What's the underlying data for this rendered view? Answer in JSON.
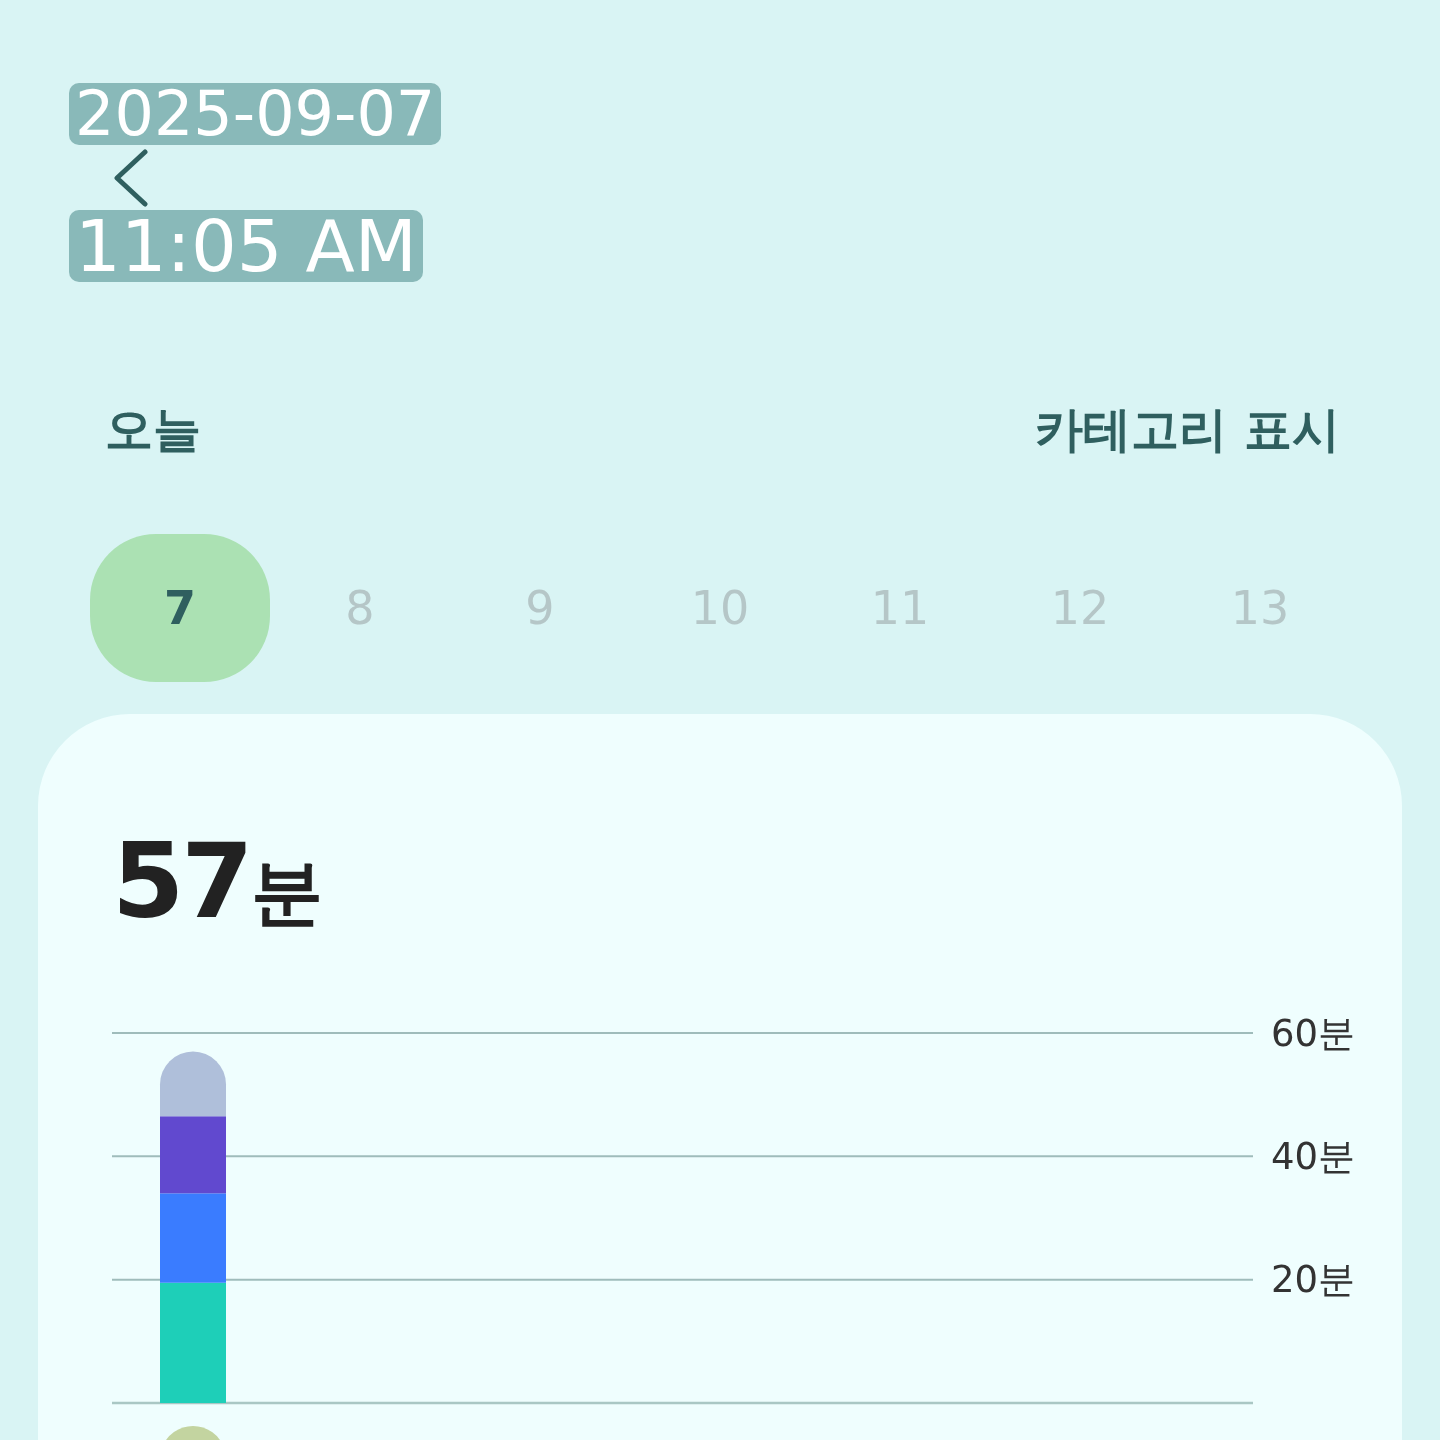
{
  "status": {
    "date": "2025-09-07",
    "time": "11:05 AM"
  },
  "header": {
    "title": "오늘",
    "action": "카테고리 표시"
  },
  "days": [
    {
      "label": "7",
      "selected": true
    },
    {
      "label": "8",
      "selected": false
    },
    {
      "label": "9",
      "selected": false
    },
    {
      "label": "10",
      "selected": false
    },
    {
      "label": "11",
      "selected": false
    },
    {
      "label": "12",
      "selected": false
    },
    {
      "label": "13",
      "selected": false
    }
  ],
  "summary": {
    "total_value": "57",
    "total_unit": "분",
    "chart_data": {
      "type": "bar",
      "stacked": true,
      "ylim": [
        0,
        60
      ],
      "yticks": [
        {
          "value": 20,
          "label": "20분"
        },
        {
          "value": 40,
          "label": "40분"
        },
        {
          "value": 60,
          "label": "60분"
        }
      ],
      "series": [
        {
          "color": "#1ecfb8",
          "values": [
            19.5
          ]
        },
        {
          "color": "#3a7cff",
          "values": [
            14.5
          ]
        },
        {
          "color": "#6149cf",
          "values": [
            12.5
          ]
        },
        {
          "color": "#afbfda",
          "values": [
            10.5
          ]
        }
      ]
    }
  }
}
